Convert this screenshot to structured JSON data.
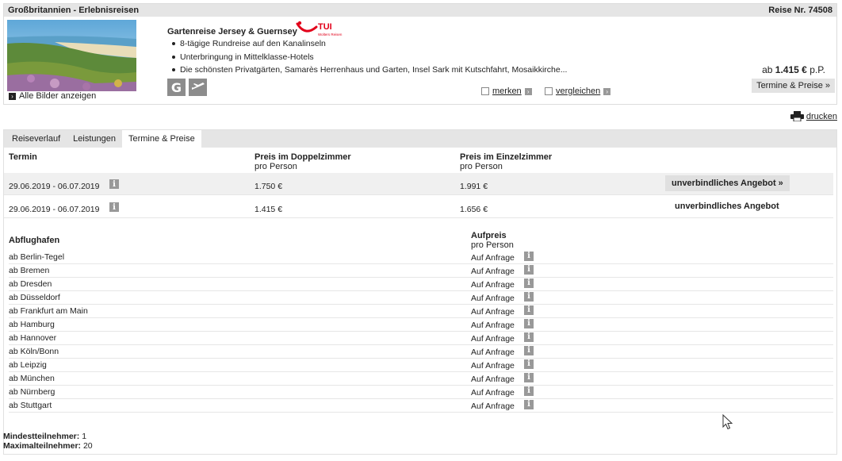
{
  "card": {
    "category": "Großbritannien - Erlebnisreisen",
    "trip_number": "Reise Nr. 74508",
    "all_pictures": "Alle Bilder anzeigen",
    "title": "Gartenreise Jersey & Guernsey",
    "brand": {
      "name": "TUI",
      "subline": "Wolters Reisen",
      "color": "#e2001a"
    },
    "features": [
      "8-tägige Rundreise auf den Kanalinseln",
      "Unterbringung in Mittelklasse-Hotels",
      "Die schönsten Privatgärten, Samarès Herrenhaus und Garten, Insel Sark mit Kutschfahrt, Mosaikkirche..."
    ],
    "badges": [
      {
        "icon": "g-letter-icon",
        "glyph": "G"
      },
      {
        "icon": "airplane-icon"
      }
    ],
    "remember": "merken",
    "compare": "vergleichen",
    "price_prefix": "ab",
    "price_value": "1.415 €",
    "price_suffix": "p.P.",
    "dates_button": "Termine & Preise »"
  },
  "print": {
    "label": "drucken",
    "icon": "printer-icon"
  },
  "tabs": [
    "Reiseverlauf",
    "Leistungen",
    "Termine & Preise"
  ],
  "active_tab": "Termine & Preise",
  "dates_table": {
    "headers": {
      "termin": "Termin",
      "double": "Preis im Doppelzimmer",
      "double_sub": "pro Person",
      "single": "Preis im Einzelzimmer",
      "single_sub": "pro Person"
    },
    "rows": [
      {
        "dates": "29.06.2019 - 06.07.2019",
        "double": "1.750 €",
        "single": "1.991 €",
        "offer": "unverbindliches Angebot »"
      },
      {
        "dates": "29.06.2019 - 06.07.2019",
        "double": "1.415 €",
        "single": "1.656 €",
        "offer": "unverbindliches Angebot"
      }
    ]
  },
  "flights": {
    "header_airport": "Abflughafen",
    "header_surcharge": "Aufpreis",
    "header_surcharge_sub": "pro Person",
    "rows": [
      {
        "airport": "ab Berlin-Tegel",
        "surcharge": "Auf Anfrage"
      },
      {
        "airport": "ab Bremen",
        "surcharge": "Auf Anfrage"
      },
      {
        "airport": "ab Dresden",
        "surcharge": "Auf Anfrage"
      },
      {
        "airport": "ab Düsseldorf",
        "surcharge": "Auf Anfrage"
      },
      {
        "airport": "ab Frankfurt am Main",
        "surcharge": "Auf Anfrage"
      },
      {
        "airport": "ab Hamburg",
        "surcharge": "Auf Anfrage"
      },
      {
        "airport": "ab Hannover",
        "surcharge": "Auf Anfrage"
      },
      {
        "airport": "ab Köln/Bonn",
        "surcharge": "Auf Anfrage"
      },
      {
        "airport": "ab Leipzig",
        "surcharge": "Auf Anfrage"
      },
      {
        "airport": "ab München",
        "surcharge": "Auf Anfrage"
      },
      {
        "airport": "ab Nürnberg",
        "surcharge": "Auf Anfrage"
      },
      {
        "airport": "ab Stuttgart",
        "surcharge": "Auf Anfrage"
      }
    ]
  },
  "limits": {
    "min_label": "Mindestteilnehmer:",
    "min_value": "1",
    "max_label": "Maximalteilnehmer:",
    "max_value": "20"
  },
  "info_glyph": "i"
}
